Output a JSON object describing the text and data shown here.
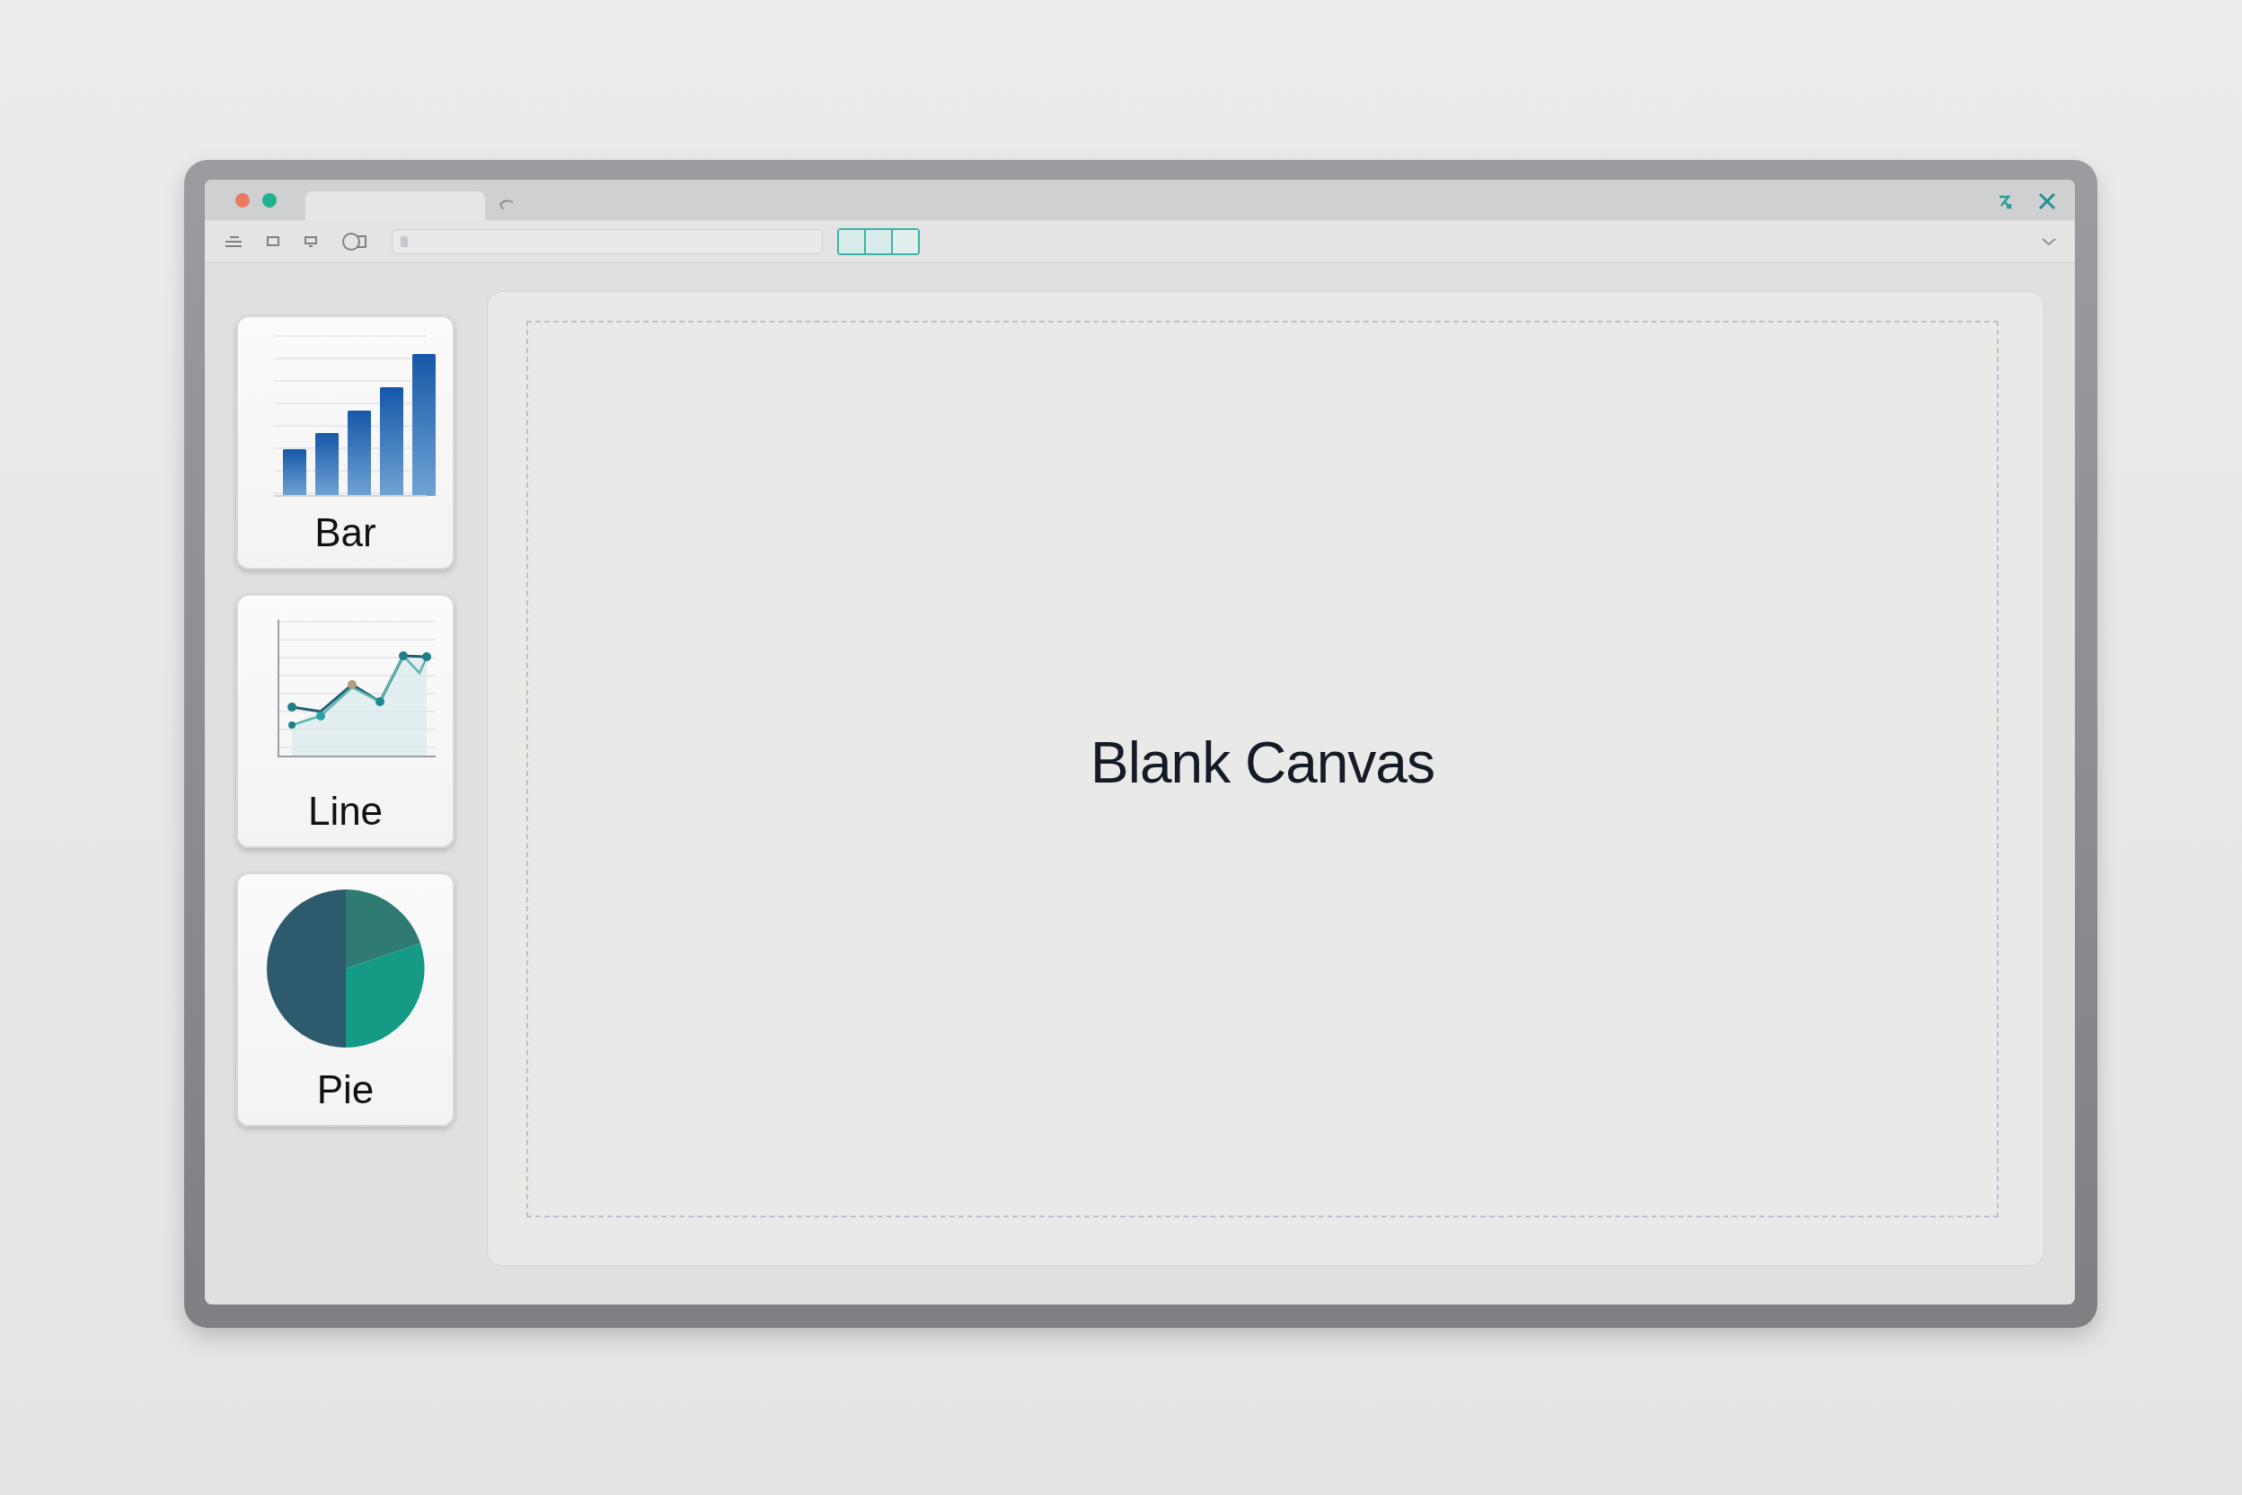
{
  "sidebar": {
    "items": [
      {
        "label": "Bar",
        "kind": "bar"
      },
      {
        "label": "Line",
        "kind": "line"
      },
      {
        "label": "Pie",
        "kind": "pie"
      }
    ]
  },
  "canvas": {
    "label": "Blank Canvas"
  }
}
